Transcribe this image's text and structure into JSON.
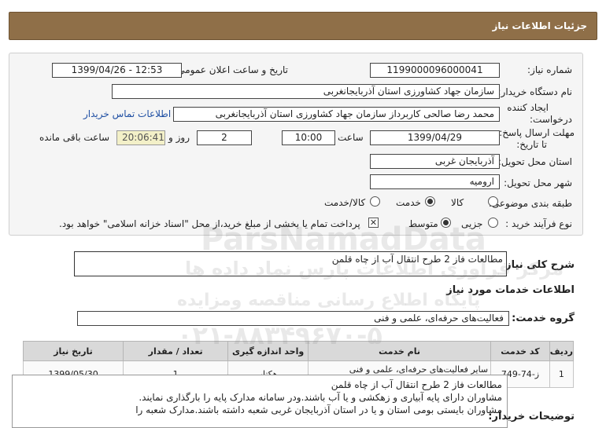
{
  "header": {
    "title": "جزئیات اطلاعات نیاز"
  },
  "form": {
    "need_number_label": "شماره نیاز:",
    "need_number": "1199000096000041",
    "announce_label": "تاریخ و ساعت اعلان عمومی:",
    "announce_value": "1399/04/26 - 12:53",
    "buyer_org_label": "نام دستگاه خریدار:",
    "buyer_org": "سازمان جهاد کشاورزی استان آذربایجانغربی",
    "requester_label_1": "ایجاد کننده",
    "requester_label_2": "درخواست:",
    "requester": "محمد رضا صالحی کاربرداز سازمان جهاد کشاورزی استان آذربایجانغربی",
    "contact_link": "اطلاعات تماس خریدار",
    "deadline_label_1": "مهلت ارسال پاسخ:",
    "deadline_label_2": "تا تاریخ:",
    "deadline_date": "1399/04/29",
    "time_label": "ساعت",
    "deadline_time": "10:00",
    "days_value": "2",
    "days_label": "روز و",
    "remaining_time": "20:06:41",
    "remaining_label": "ساعت باقی مانده",
    "province_label": "استان محل تحویل:",
    "province": "آذربایجان غربی",
    "city_label": "شهر محل تحویل:",
    "city": "ارومیه",
    "category_label": "طبقه بندی موضوعی:",
    "category_options": [
      "کالا",
      "خدمت",
      "کالا/خدمت"
    ],
    "category_selected": "خدمت",
    "process_label": "نوع فرآیند خرید :",
    "process_options": [
      "جزیی",
      "متوسط"
    ],
    "process_selected": "متوسط",
    "payment_note": "پرداخت تمام یا بخشی از مبلغ خرید،از محل \"اسناد خزانه اسلامی\" خواهد بود."
  },
  "summary": {
    "label": "شرح کلی نیاز:",
    "value": "مطالعات فاز 2 طرح انتقال آب از چاه قلمن"
  },
  "services": {
    "section_title": "اطلاعات خدمات مورد نیاز",
    "group_label": "گروه خدمت:",
    "group_value": "فعالیت‌های حرفه‌ای، علمی و فنی"
  },
  "table": {
    "headers": [
      "ردیف",
      "کد خدمت",
      "نام خدمت",
      "واحد اندازه گیری",
      "تعداد / مقدار",
      "تاریخ نیاز"
    ],
    "rows": [
      [
        "1",
        "ز-74-749",
        "سایر فعالیت‌های حرفه‌ای، علمی و فنی طبقه‌بندی‌نشده در جای دیگر",
        "هکتار",
        "1",
        "1399/05/30"
      ]
    ]
  },
  "description": {
    "label": "توضیحات خریدار:",
    "lines": [
      "مطالعات فاز 2 طرح انتقال آب از چاه قلمن",
      "مشاوران دارای پایه آبیاری و زهکشی و یا آب باشند.ودر سامانه مدارک  پایه را بارگذاری نمایند.",
      "مشاوران بایستی بومی استان و یا در استان آذربایجان غربی شعبه داشته باشند.مدارک شعبه را"
    ]
  },
  "watermark": {
    "line1": "ParsNamadData",
    "line2": "مرکز فراوری اطلاعات پارس نماد داده ها",
    "line3": "پایگاه اطلاع رسانی مناقصه ومزایده",
    "line4": "۰۲۱-۸۸۳۴۹۶۷۰-۵"
  }
}
